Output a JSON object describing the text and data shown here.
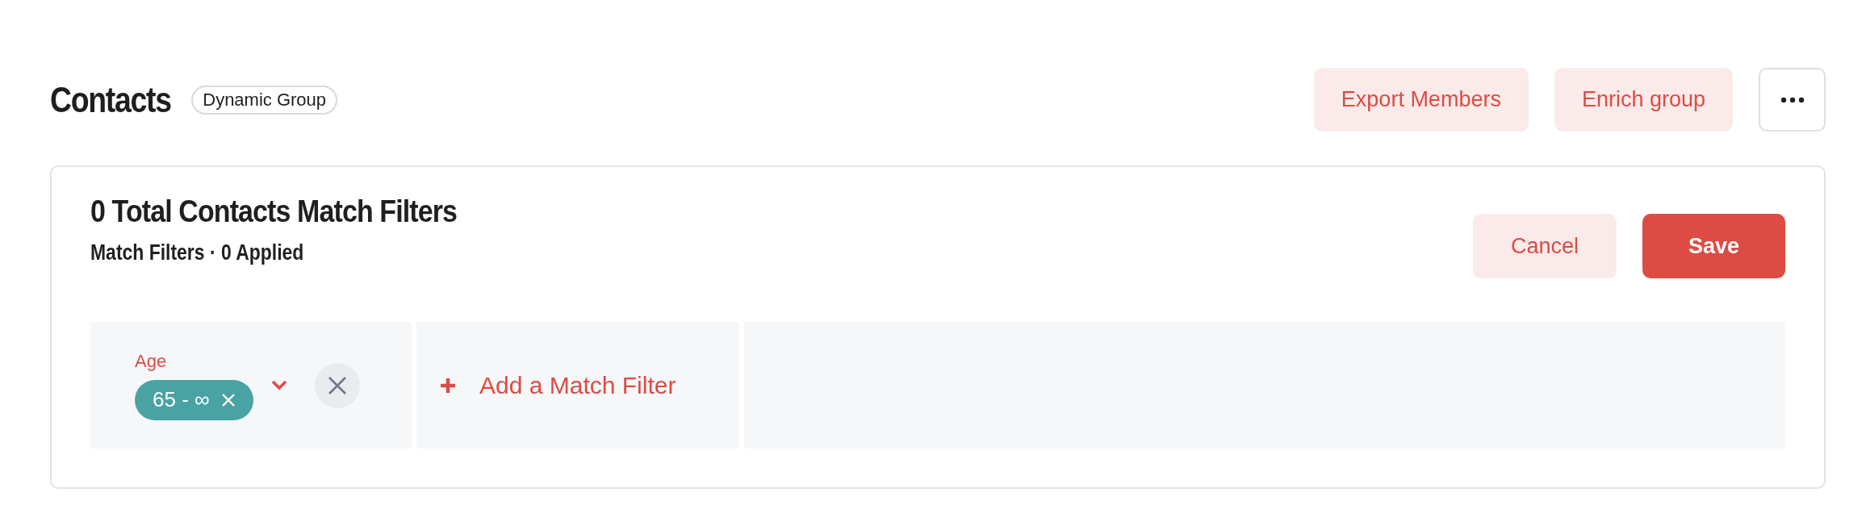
{
  "header": {
    "title": "Contacts",
    "badge": "Dynamic Group",
    "actions": [
      {
        "kind": "secondary",
        "label": "Export Members"
      },
      {
        "kind": "secondary",
        "label": "Enrich group"
      },
      {
        "kind": "more"
      }
    ]
  },
  "card": {
    "title": "0 Total Contacts Match Filters",
    "subtitle": "Match Filters · 0 Applied",
    "actions": [
      {
        "kind": "secondary",
        "label": "Cancel"
      },
      {
        "kind": "primary",
        "label": "Save"
      }
    ],
    "filters": [
      {
        "label": "Age",
        "values": [
          "65 - ∞"
        ]
      }
    ],
    "add_filter": "Add a Match Filter"
  }
}
